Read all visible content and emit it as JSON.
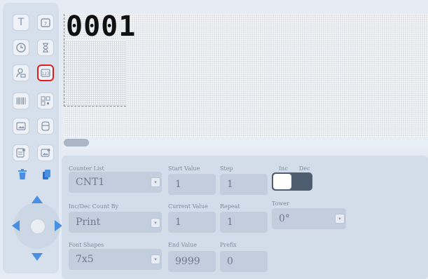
{
  "canvas": {
    "counter_preview": "0001"
  },
  "properties": {
    "counter_list": {
      "label": "Counter List",
      "value": "CNT1"
    },
    "start_value": {
      "label": "Start Value",
      "value": "1"
    },
    "step": {
      "label": "Step",
      "value": "1"
    },
    "inc_label": "Inc",
    "dec_label": "Dec",
    "inc_dec_count_by": {
      "label": "Inc/Dec Count By",
      "value": "Print"
    },
    "current_value": {
      "label": "Current Value",
      "value": "1"
    },
    "repeat": {
      "label": "Repeat",
      "value": "1"
    },
    "tower": {
      "label": "Tower",
      "value": "0°"
    },
    "font_shapes": {
      "label": "Font Shapes",
      "value": "7x5"
    },
    "end_value": {
      "label": "End Value",
      "value": "9999"
    },
    "prefix": {
      "label": "Prefix",
      "value": "0"
    }
  },
  "colors": {
    "selected_outline": "#e01e1e",
    "accent_blue": "#4a90e2",
    "toggle_dark": "#4e5d6f"
  }
}
